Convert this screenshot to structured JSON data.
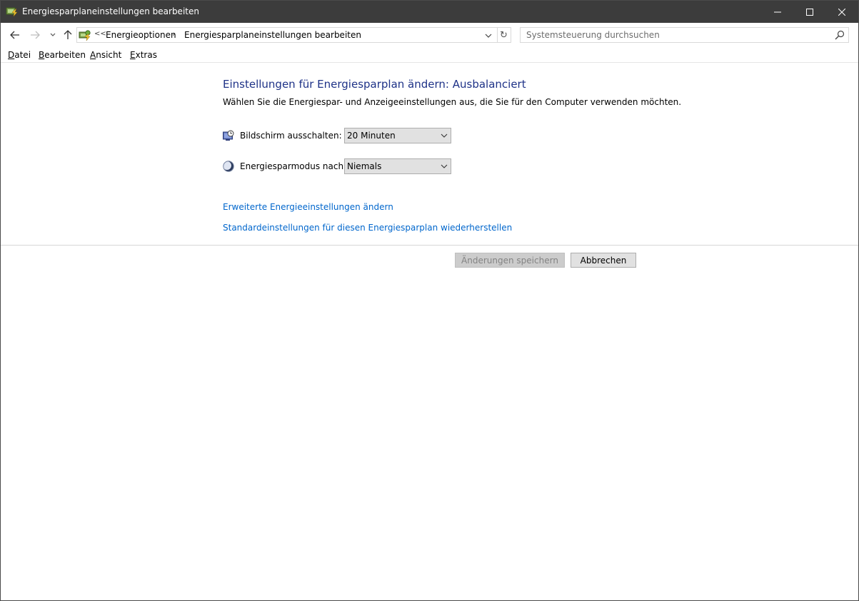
{
  "window": {
    "title": "Energiesparplaneinstellungen bearbeiten",
    "app_icon": "power-options-icon",
    "controls": [
      "minimize-icon",
      "maximize-icon",
      "close-icon"
    ]
  },
  "navigation": {
    "back_icon": "arrow-left-icon",
    "forward_icon": "arrow-right-icon",
    "recent_icon": "chevron-down-icon",
    "up_icon": "arrow-up-icon",
    "refresh_glyph": "↻",
    "breadcrumb_overflow": "<<",
    "breadcrumb_separator": "›",
    "breadcrumb": [
      "Energieoptionen",
      "Energiesparplaneinstellungen bearbeiten"
    ]
  },
  "search": {
    "placeholder": "Systemsteuerung durchsuchen",
    "value": ""
  },
  "menu": {
    "items": [
      "Datei",
      "Bearbeiten",
      "Ansicht",
      "Extras"
    ]
  },
  "content": {
    "heading": "Einstellungen für Energiesparplan ändern: Ausbalanciert",
    "description": "Wählen Sie die Energiespar- und Anzeigeeinstellungen aus, die Sie für den Computer verwenden möchten.",
    "settings": [
      {
        "label": "Bildschirm ausschalten:",
        "icon": "display-clock-icon",
        "value": "20 Minuten"
      },
      {
        "label": "Energiesparmodus nach:",
        "icon": "moon-icon",
        "value": "Niemals"
      }
    ],
    "links": {
      "advanced": "Erweiterte Energieeinstellungen ändern",
      "restore": "Standardeinstellungen für diesen Energiesparplan wiederherstellen"
    }
  },
  "buttons": {
    "save": "Änderungen speichern",
    "save_enabled": false,
    "cancel": "Abbrechen"
  },
  "colors": {
    "titlebar": "#3c3c3c",
    "heading": "#1e3287",
    "link": "#0066cc"
  }
}
